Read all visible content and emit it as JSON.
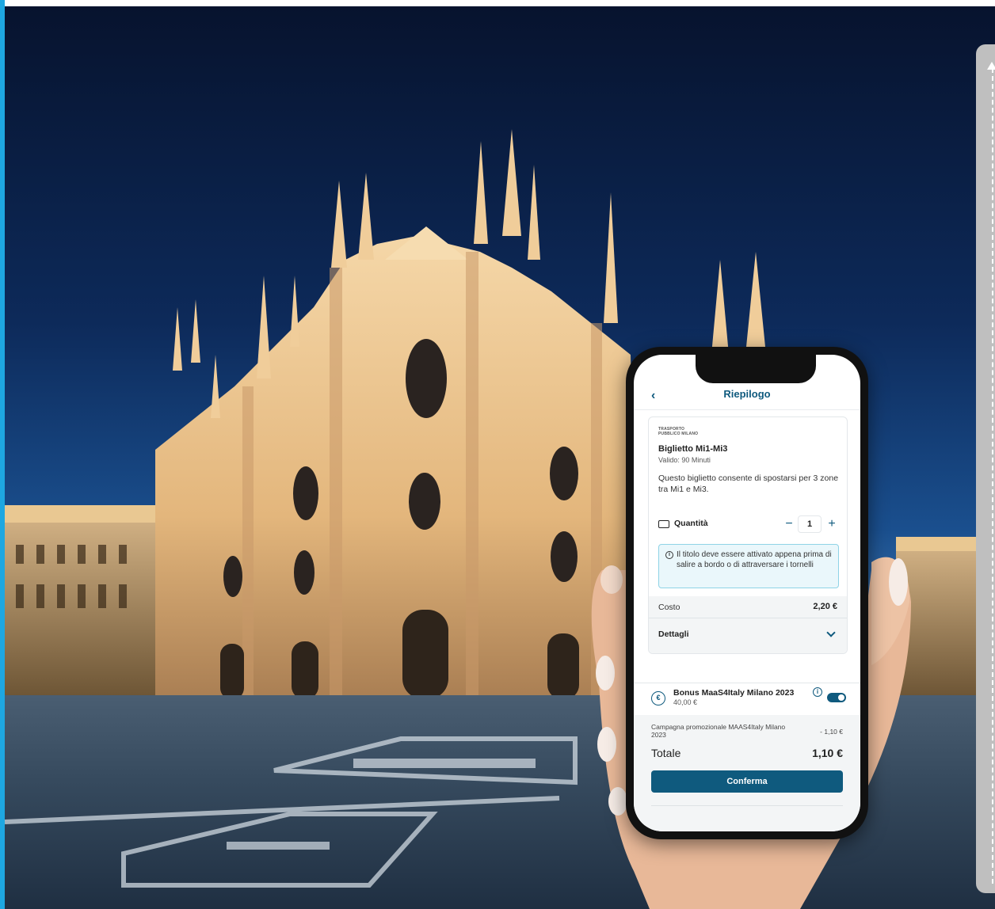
{
  "app": {
    "title": "Riepilogo",
    "back_icon": "chevron-left-icon"
  },
  "ticket": {
    "operator_logo_text": "TRASPORTO PUBBLICO MILANO",
    "name": "Biglietto Mi1-Mi3",
    "validity": "Valido: 90 Minuti",
    "description": "Questo biglietto consente di spostarsi per 3 zone tra Mi1 e Mi3.",
    "quantity_label": "Quantità",
    "quantity_value": "1",
    "minus_label": "−",
    "plus_label": "+",
    "info_icon_label": "i",
    "info_text": "Il titolo deve essere attivato appena prima di salire a bordo o di attraversare i tornelli",
    "cost_label": "Costo",
    "cost_value": "2,20 €",
    "details_label": "Dettagli"
  },
  "bonus": {
    "icon_label": "€",
    "title": "Bonus MaaS4Italy Milano 2023",
    "amount": "40,00 €",
    "info_icon_label": "i",
    "enabled": true
  },
  "summary": {
    "promo_label": "Campagna promozionale MAAS4Italy Milano 2023",
    "promo_value": "- 1,10 €",
    "total_label": "Totale",
    "total_value": "1,10 €",
    "confirm_label": "Conferma"
  },
  "colors": {
    "accent": "#0f5a7e",
    "info_bg": "#eaf7fb",
    "info_border": "#8fd3e6",
    "left_strip": "#1ea7e1",
    "scroll_rail": "#bfbfbf"
  }
}
